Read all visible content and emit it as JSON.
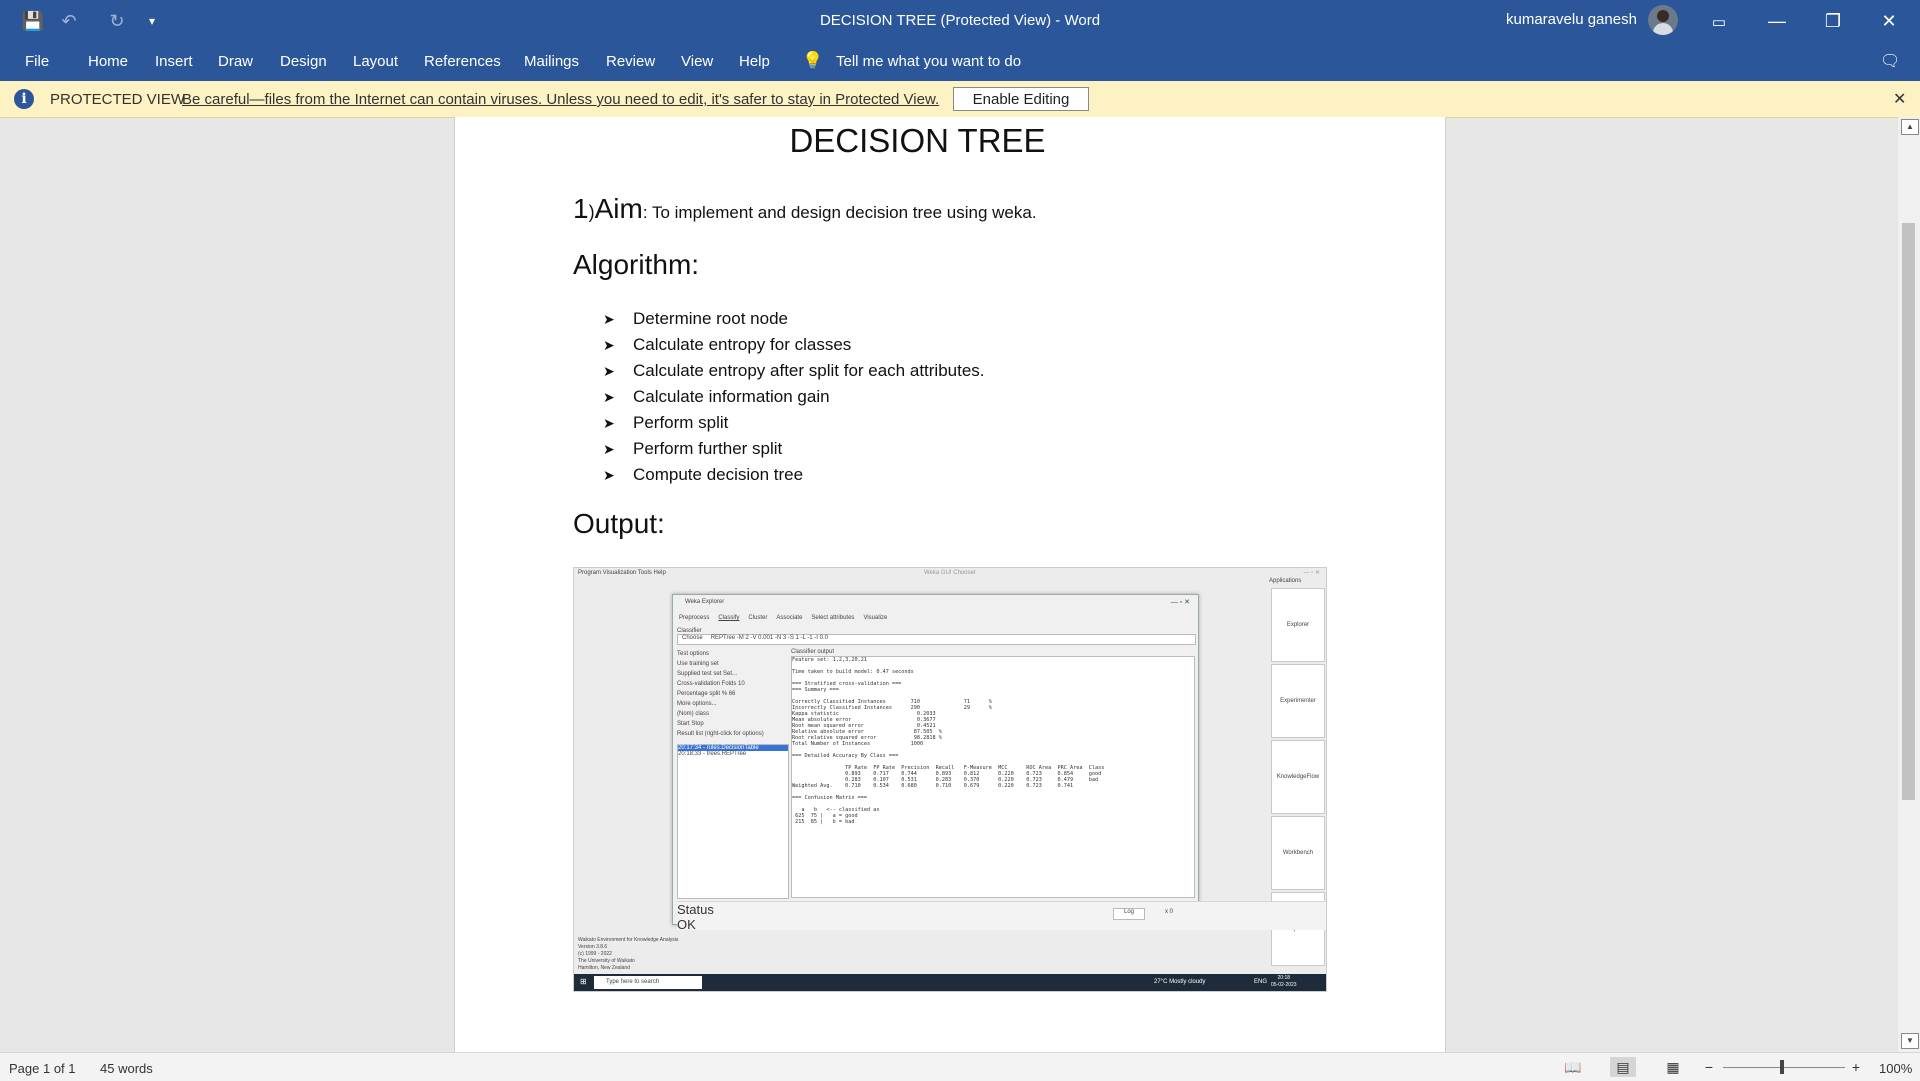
{
  "app": {
    "title": "DECISION TREE (Protected View)  -  Word",
    "user_name": "kumaravelu ganesh",
    "quick_access": {
      "save": "💾",
      "undo": "↶",
      "redo": "↻",
      "customize": "▾"
    },
    "window_buttons": {
      "ribbon_display": "▭",
      "minimize": "—",
      "restore": "❐",
      "close": "✕"
    }
  },
  "ribbon": {
    "tabs": [
      "File",
      "Home",
      "Insert",
      "Draw",
      "Design",
      "Layout",
      "References",
      "Mailings",
      "Review",
      "View",
      "Help"
    ],
    "tell_me": "Tell me what you want to do",
    "tell_me_icon": "💡"
  },
  "protected_view": {
    "label": "PROTECTED VIEW",
    "message": "Be careful—files from the Internet can contain viruses. Unless you need to edit, it's safer to stay in Protected View.",
    "enable_button": "Enable Editing",
    "close": "✕",
    "info_icon": "i"
  },
  "document": {
    "title": "DECISION TREE",
    "aim": {
      "number": "1",
      "paren": ")",
      "word": "Aim",
      "text": ": To implement and design decision tree using weka."
    },
    "algorithm_heading": "Algorithm:",
    "bullet_glyph": "➤",
    "steps": [
      "Determine root node",
      "Calculate entropy for classes",
      "Calculate entropy after split for each attributes.",
      "Calculate information gain",
      "Perform split",
      "Perform further split",
      "Compute decision tree"
    ],
    "output_heading": "Output:"
  },
  "screenshot": {
    "gui_menu": "Program   Visualization   Tools   Help",
    "gui_title": "Weka GUI Chooser",
    "gui_win": "—  ▫  ✕",
    "applications_label": "Applications",
    "applications": [
      "Explorer",
      "Experimenter",
      "KnowledgeFlow",
      "Workbench",
      "Simple CLI"
    ],
    "explorer_title": "Weka Explorer",
    "explorer_buttons": "—  ▫  ✕",
    "explorer_tabs": [
      "Preprocess",
      "Classify",
      "Cluster",
      "Associate",
      "Select attributes",
      "Visualize"
    ],
    "classifier_label": "Classifier",
    "choose_button": "Choose",
    "choose_value": "REPTree -M 2 -V 0.001 -N 3 -S 1 -L -1 -I 0.0",
    "test_options": [
      "Test options",
      "Use training set",
      "Supplied test set   Set...",
      "Cross-validation   Folds  10",
      "Percentage split   %  66",
      "More options...",
      "(Nom) class",
      "Start        Stop",
      "Result list (right-click for options)"
    ],
    "results": [
      "20:17:34 - rules.DecisionTable",
      "20:18:33 - trees.REPTree"
    ],
    "output_label": "Classifier output",
    "output_text": "Feature set: 1,2,3,20,21\n\nTime taken to build model: 0.47 seconds\n\n=== Stratified cross-validation ===\n=== Summary ===\n\nCorrectly Classified Instances        710              71      %\nIncorrectly Classified Instances      290              29      %\nKappa statistic                         0.2033\nMean absolute error                     0.3677\nRoot mean squared error                 0.4521\nRelative absolute error                87.505  %\nRoot relative squared error            98.2818 %\nTotal Number of Instances             1000\n\n=== Detailed Accuracy By Class ===\n\n                 TP Rate  FP Rate  Precision  Recall   F-Measure  MCC      ROC Area  PRC Area  Class\n                 0.893    0.717    0.744      0.893    0.812      0.220    0.723     0.854     good\n                 0.283    0.107    0.531      0.283    0.370      0.220    0.723     0.479     bad\nWeighted Avg.    0.710    0.534    0.680      0.710    0.679      0.220    0.723     0.741\n\n=== Confusion Matrix ===\n\n   a   b   <-- classified as\n 625  75 |   a = good\n 215  85 |   b = bad",
    "status_label": "Status",
    "status_value": "OK",
    "log_button": "Log",
    "x_count": "x 0",
    "footer_lines": [
      "Waikato Environment for Knowledge Analysis",
      "Version 3.8.6",
      "(c) 1999 - 2022",
      "The University of Waikato",
      "Hamilton, New Zealand"
    ],
    "taskbar_search": "Type here to search",
    "taskbar_weather": "27°C  Mostly cloudy",
    "taskbar_lang": "ENG",
    "taskbar_time": "20:18",
    "taskbar_date": "05-02-2023"
  },
  "statusbar": {
    "page": "Page 1 of 1",
    "words": "45 words",
    "zoom": "100%",
    "zoom_minus": "−",
    "zoom_plus": "+",
    "view_icons": [
      "read-mode-icon",
      "print-layout-icon",
      "web-layout-icon"
    ],
    "zoom_level": 1.0
  },
  "scrollbar": {
    "up": "▲",
    "down": "▼"
  }
}
